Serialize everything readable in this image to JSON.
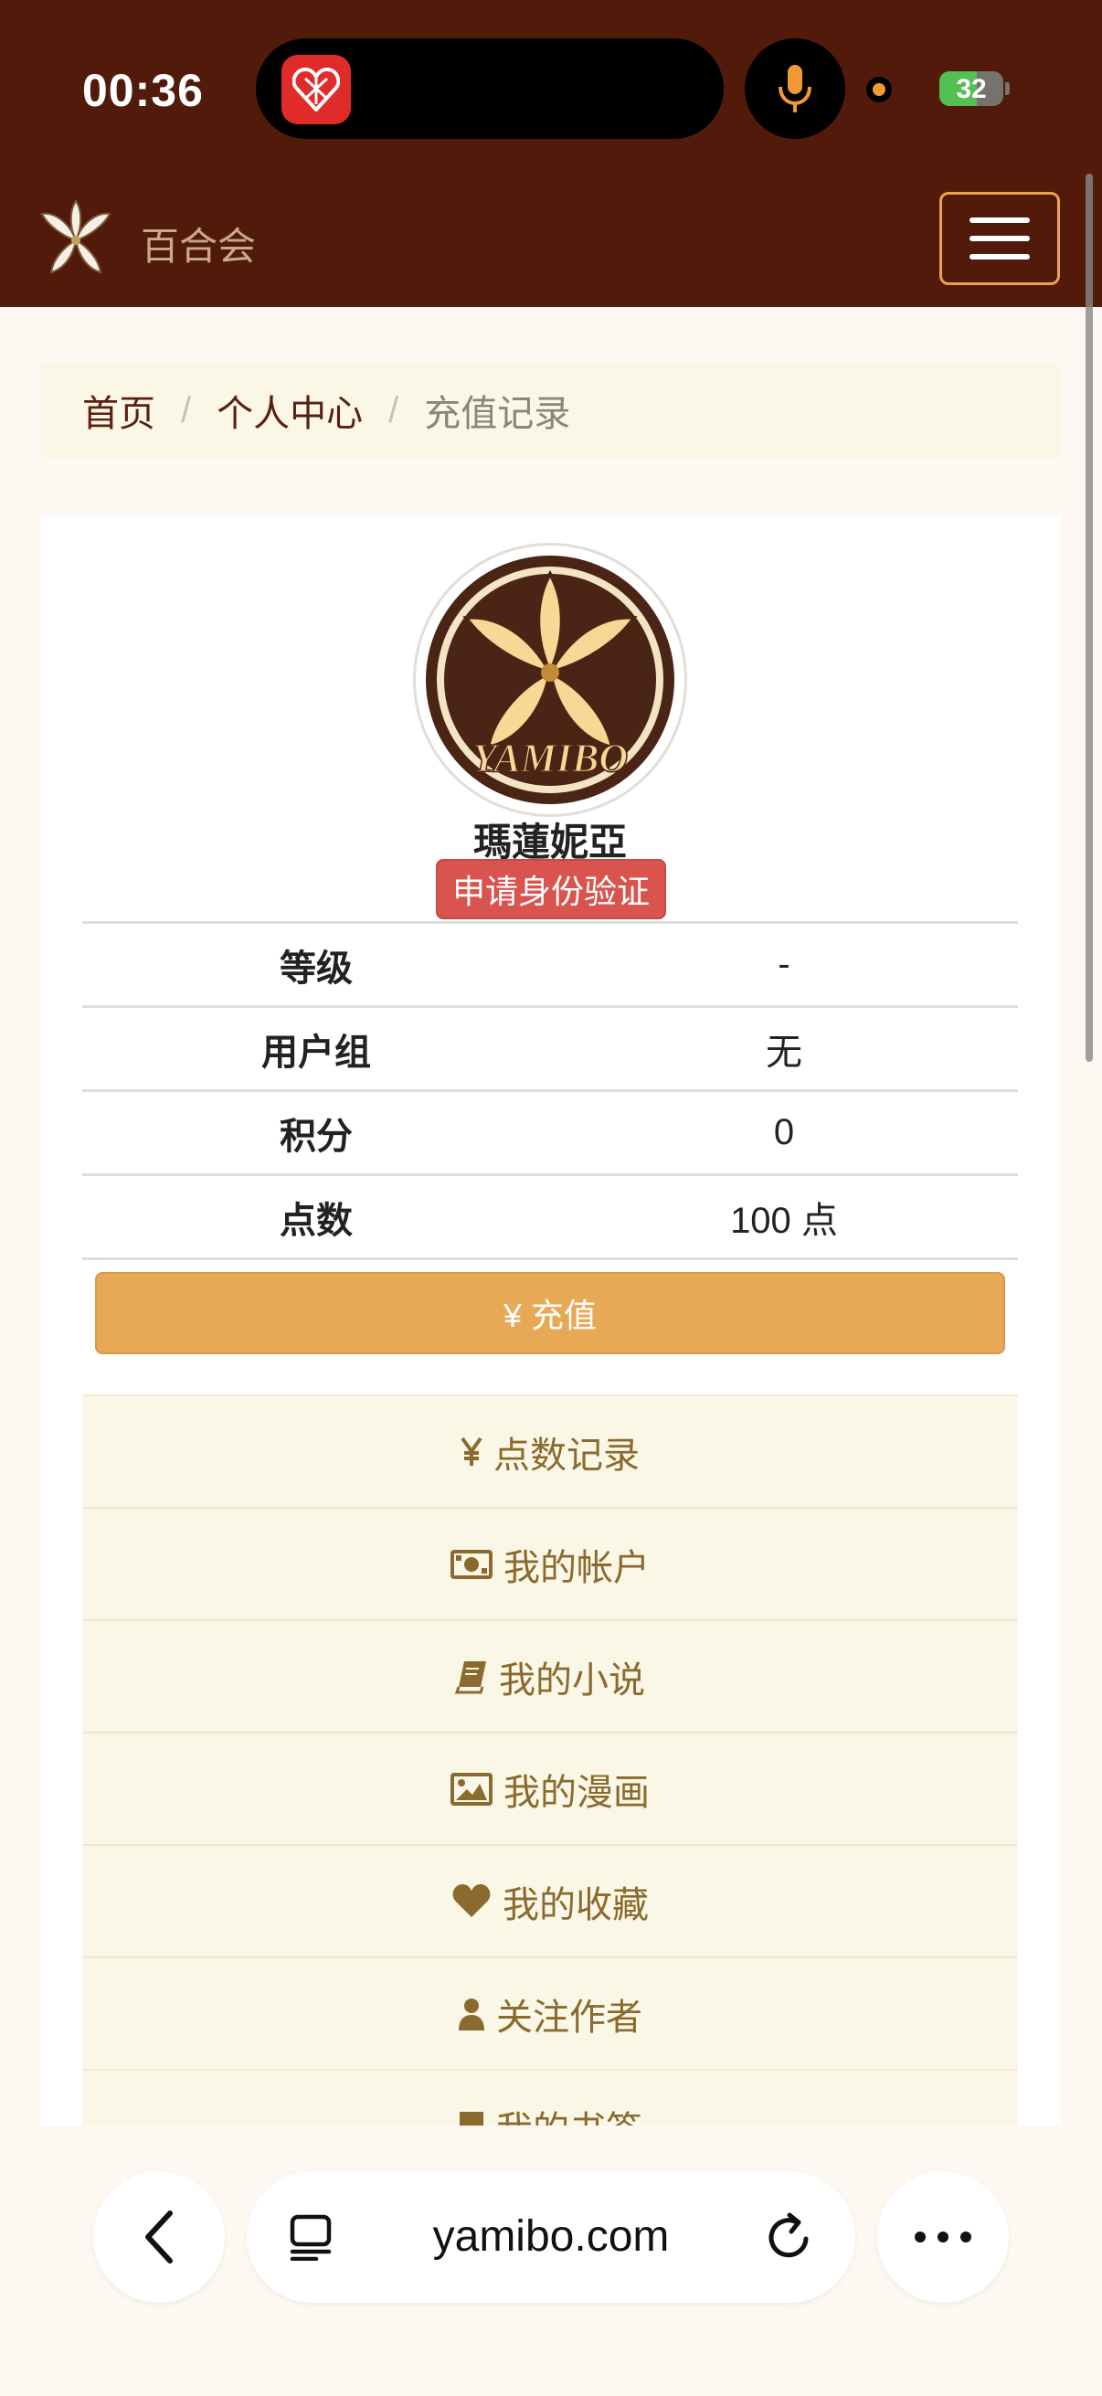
{
  "status_bar": {
    "time": "00:36",
    "battery": "32"
  },
  "navbar": {
    "brand": "百合会"
  },
  "breadcrumb": {
    "home": "首页",
    "sep": "/",
    "center": "个人中心",
    "current": "充值记录"
  },
  "profile": {
    "username": "瑪蓮妮亞",
    "verify_label": "申请身份验证",
    "rows": [
      {
        "key": "等级",
        "value": "-"
      },
      {
        "key": "用户组",
        "value": "无"
      },
      {
        "key": "积分",
        "value": "0"
      },
      {
        "key": "点数",
        "value": "100 点"
      }
    ],
    "recharge_label": "¥ 充值"
  },
  "menu": {
    "items": [
      {
        "icon": "yen-icon",
        "label": "点数记录"
      },
      {
        "icon": "money-bill-icon",
        "label": "我的帐户"
      },
      {
        "icon": "book-icon",
        "label": "我的小说"
      },
      {
        "icon": "image-icon",
        "label": "我的漫画"
      },
      {
        "icon": "heart-icon",
        "label": "我的收藏"
      },
      {
        "icon": "user-icon",
        "label": "关注作者"
      },
      {
        "icon": "bookmark-icon",
        "label": "我的书签"
      }
    ]
  },
  "browser": {
    "url": "yamibo.com"
  }
}
